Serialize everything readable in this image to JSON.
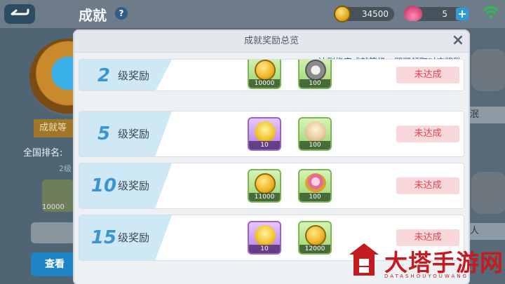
{
  "header": {
    "title": "成就",
    "help_icon_text": "?",
    "coins": "34500",
    "shells": "5",
    "plus_text": "+"
  },
  "background": {
    "rank_label": "成就等",
    "national_rank": "全国排名:",
    "level_text": "2级",
    "item_qty": "10000",
    "view_button": "查看",
    "right_label_1": "泯",
    "right_label_2": "人"
  },
  "modal": {
    "title": "成就奖励总览",
    "hint": "达到指定成就等级，即可领取对应奖励",
    "close_label": "×",
    "level_suffix": "级奖励",
    "rows": [
      {
        "level": "2",
        "status": "未达成",
        "rewards": [
          {
            "icon": "coin-icon",
            "qty": "10000",
            "frame": "green"
          },
          {
            "icon": "gear-icon",
            "qty": "100",
            "frame": "green"
          }
        ]
      },
      {
        "level": "5",
        "status": "未达成",
        "rewards": [
          {
            "icon": "chick-icon",
            "qty": "10",
            "frame": "purple"
          },
          {
            "icon": "doll-icon",
            "qty": "100",
            "frame": "green"
          }
        ]
      },
      {
        "level": "10",
        "status": "未达成",
        "rewards": [
          {
            "icon": "coin-icon",
            "qty": "11000",
            "frame": "green"
          },
          {
            "icon": "wand-icon",
            "qty": "100",
            "frame": "green"
          }
        ]
      },
      {
        "level": "15",
        "status": "未达成",
        "rewards": [
          {
            "icon": "chick-icon",
            "qty": "10",
            "frame": "purple"
          },
          {
            "icon": "coin-icon",
            "qty": "12000",
            "frame": "green"
          }
        ]
      }
    ]
  },
  "watermark": {
    "text": "大塔手游网",
    "sub": "DATASHOUYOUWANG"
  }
}
